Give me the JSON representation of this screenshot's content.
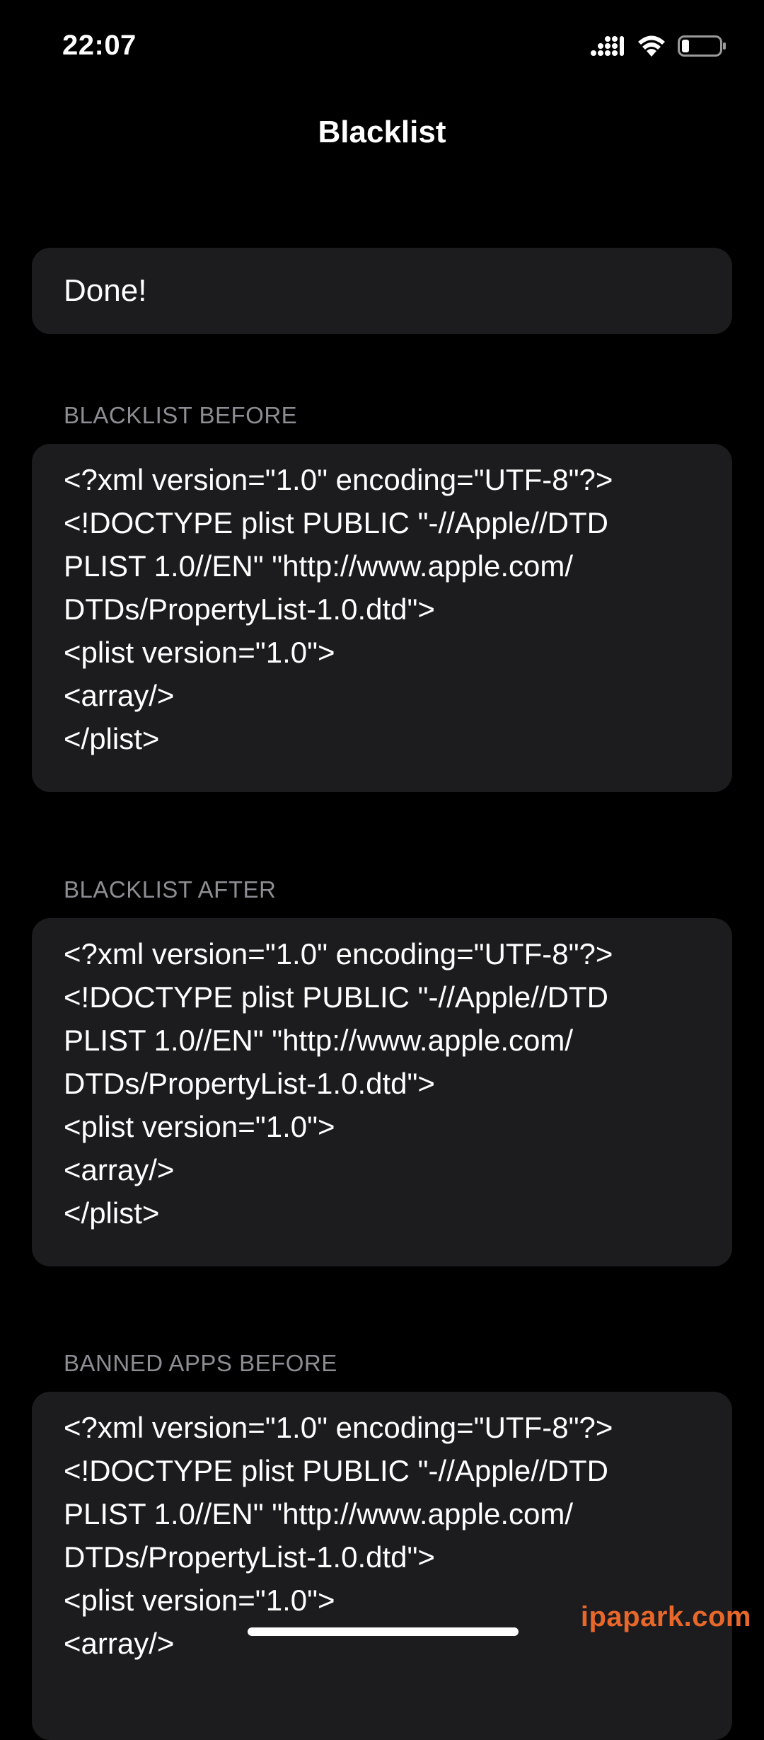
{
  "status_bar": {
    "time": "22:07",
    "icons": [
      "cellular-signal-icon",
      "wifi-icon",
      "battery-icon"
    ],
    "battery_level": 0.2
  },
  "nav": {
    "title": "Blacklist"
  },
  "result": {
    "text": "Done!"
  },
  "sections": [
    {
      "header": "BLACKLIST BEFORE",
      "lines": [
        "<?xml version=\"1.0\" encoding=\"UTF-8\"?>",
        "<!DOCTYPE plist PUBLIC \"-//Apple//DTD",
        "PLIST 1.0//EN\" \"http://www.apple.com/",
        "DTDs/PropertyList-1.0.dtd\">",
        "<plist version=\"1.0\">",
        "<array/>",
        "</plist>"
      ]
    },
    {
      "header": "BLACKLIST AFTER",
      "lines": [
        "<?xml version=\"1.0\" encoding=\"UTF-8\"?>",
        "<!DOCTYPE plist PUBLIC \"-//Apple//DTD",
        "PLIST 1.0//EN\" \"http://www.apple.com/",
        "DTDs/PropertyList-1.0.dtd\">",
        "<plist version=\"1.0\">",
        "<array/>",
        "</plist>"
      ]
    },
    {
      "header": "BANNED APPS BEFORE",
      "lines": [
        "<?xml version=\"1.0\" encoding=\"UTF-8\"?>",
        "<!DOCTYPE plist PUBLIC \"-//Apple//DTD",
        "PLIST 1.0//EN\" \"http://www.apple.com/",
        "DTDs/PropertyList-1.0.dtd\">",
        "<plist version=\"1.0\">",
        "<array/>"
      ]
    }
  ],
  "watermark": "ipapark.com",
  "colors": {
    "background": "#000000",
    "card": "#1c1c1e",
    "section_header": "#8d8d93",
    "watermark": "#e8672a"
  }
}
